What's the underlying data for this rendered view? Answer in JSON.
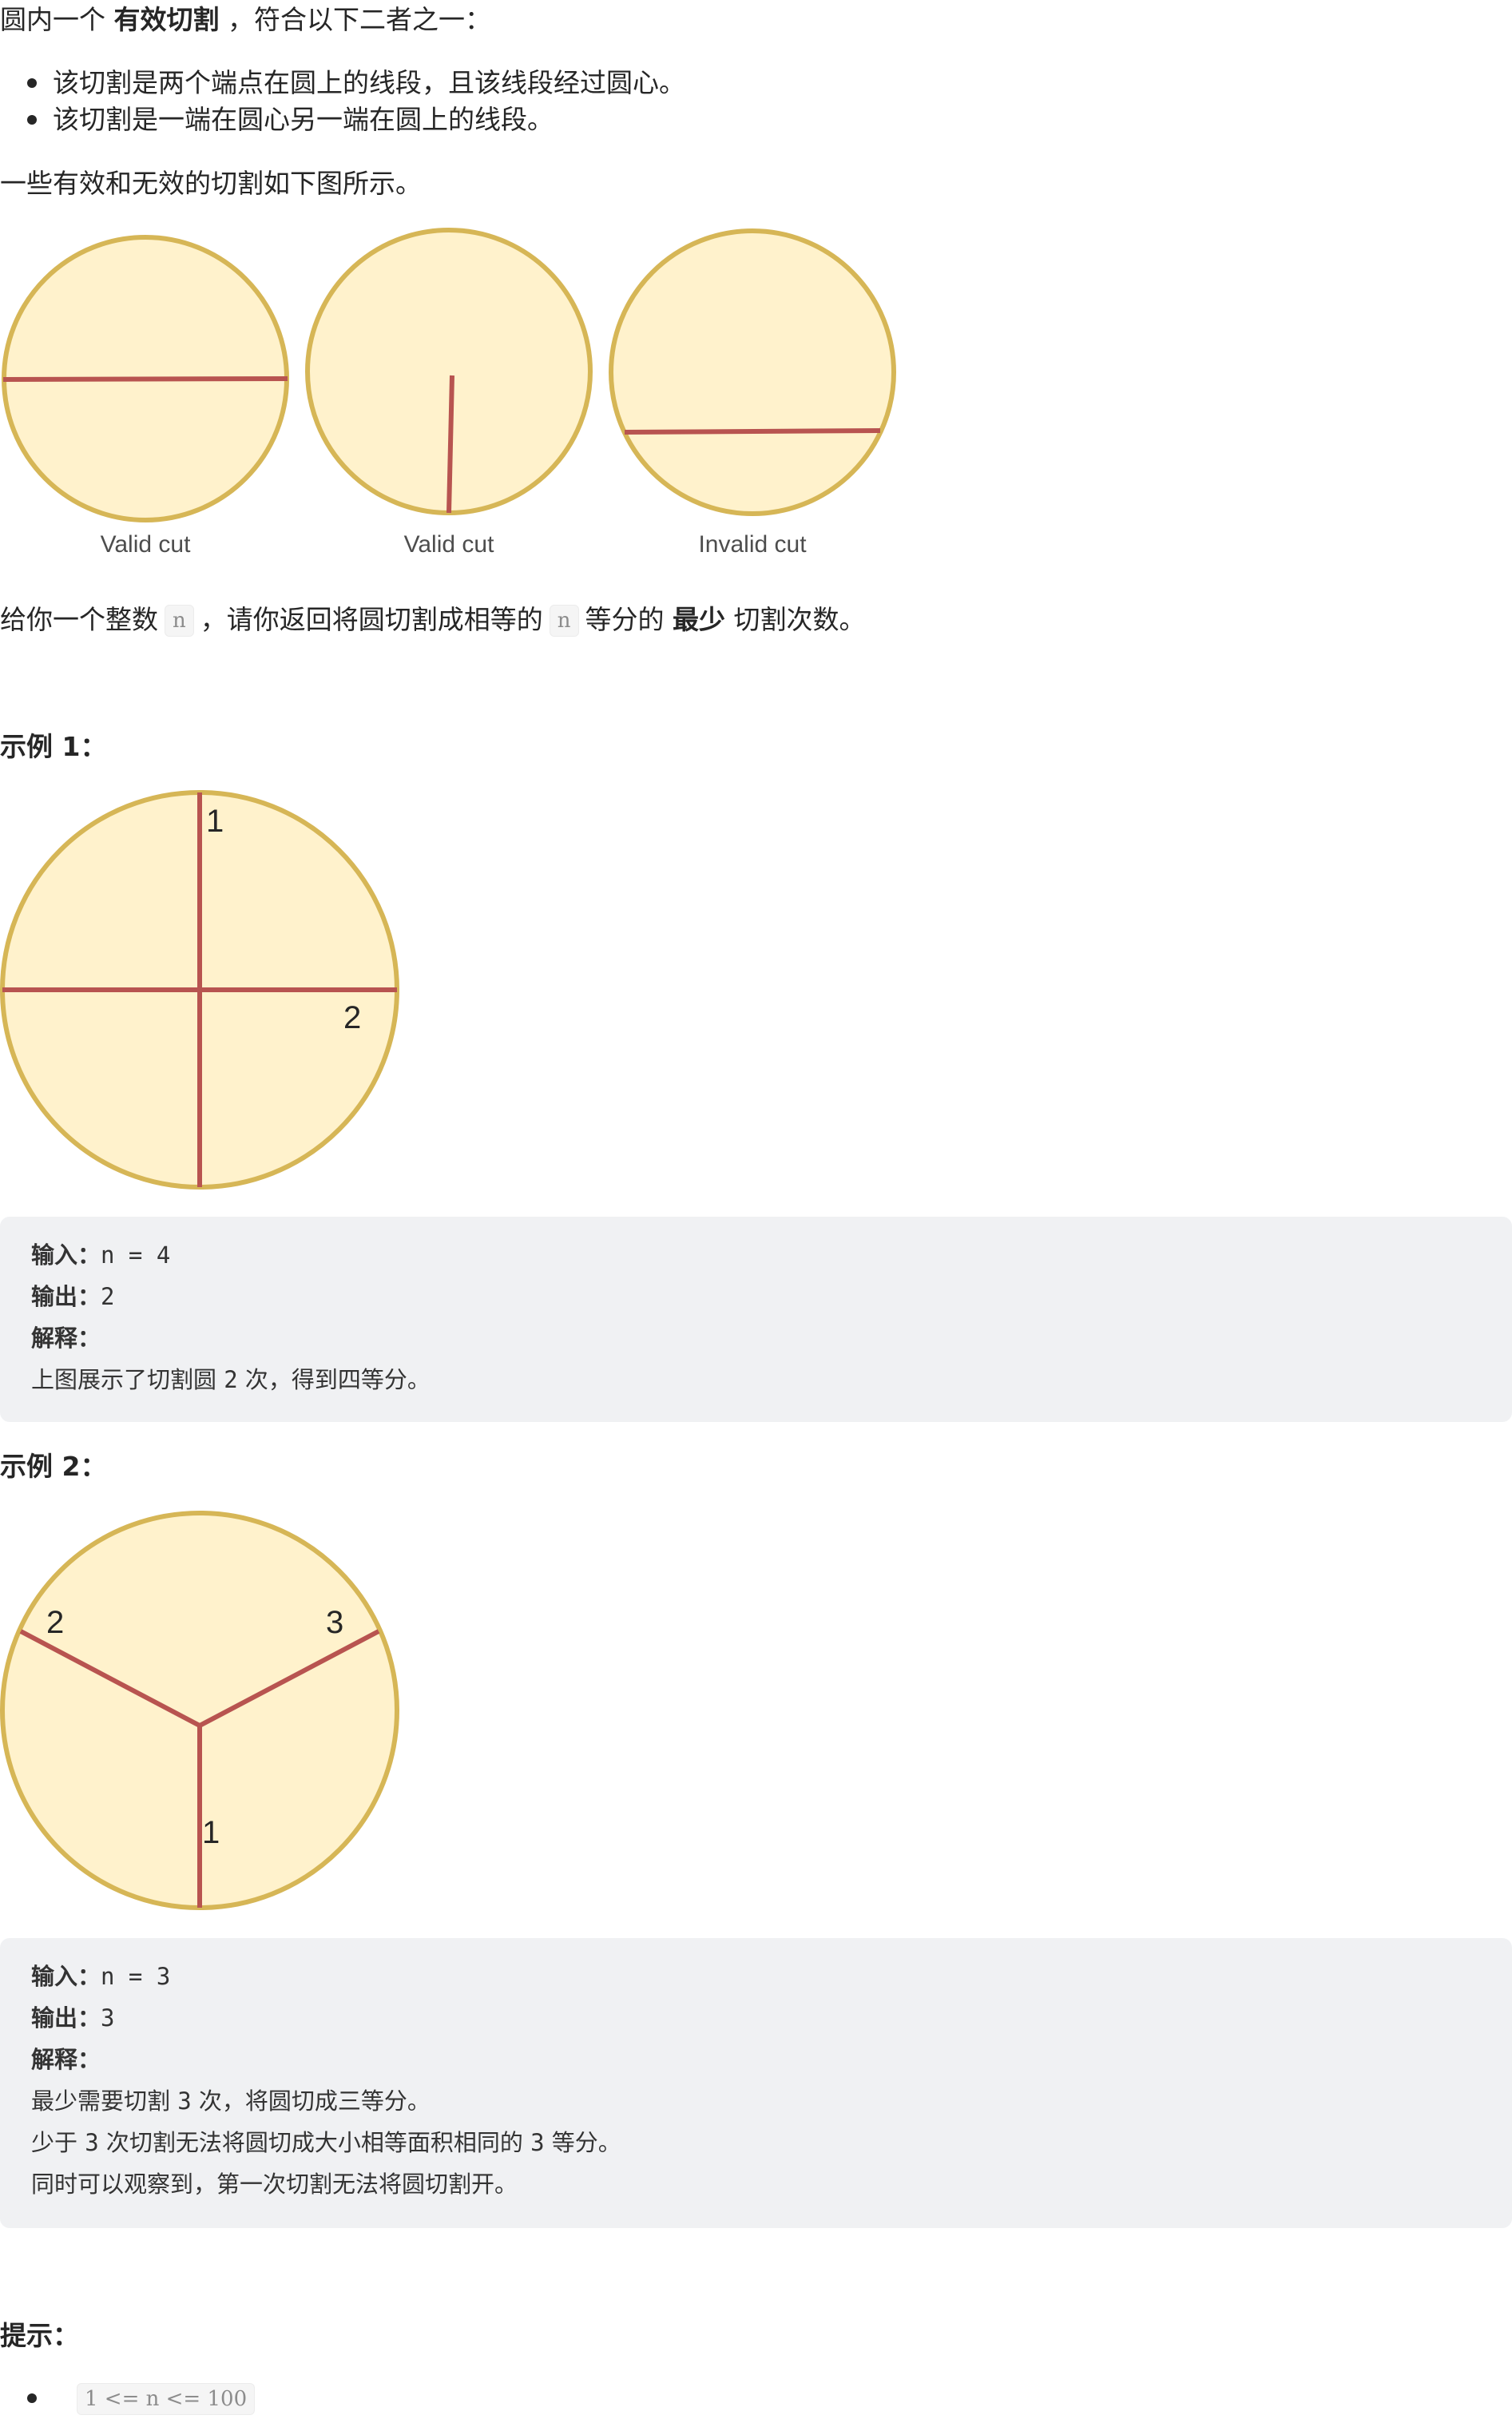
{
  "intro": {
    "prefix": "圆内一个 ",
    "emphasis": "有效切割",
    "suffix": " ，符合以下二者之一："
  },
  "rules": [
    "该切割是两个端点在圆上的线段，且该线段经过圆心。",
    "该切割是一端在圆心另一端在圆上的线段。"
  ],
  "figure_caption_intro": "一些有效和无效的切割如下图所示。",
  "figure_labels": [
    "Valid cut",
    "Valid cut",
    "Invalid cut"
  ],
  "task": {
    "prefix": "给你一个整数",
    "var": "n",
    "middle": "，请你返回将圆切割成相等的",
    "var2": "n",
    "middle2": "等分的 ",
    "emphasis": "最少",
    "suffix": " 切割次数。"
  },
  "examples": [
    {
      "title": "示例 1：",
      "cut_labels": [
        "1",
        "2"
      ],
      "input_label": "输入：",
      "input_value": "n = 4",
      "output_label": "输出：",
      "output_value": "2",
      "explain_label": "解释：",
      "explain_lines": [
        [
          "上图展示了切割圆 ",
          "2",
          " 次，得到四等分。"
        ]
      ]
    },
    {
      "title": "示例 2：",
      "cut_labels": [
        "2",
        "3",
        "1"
      ],
      "input_label": "输入：",
      "input_value": "n = 3",
      "output_label": "输出：",
      "output_value": "3",
      "explain_label": "解释：",
      "explain_lines": [
        [
          "最少需要切割 ",
          "3",
          " 次，将圆切成三等分。"
        ],
        [
          "少于 ",
          "3",
          " 次切割无法将圆切成大小相等面积相同的 ",
          "3",
          " 等分。"
        ],
        [
          "同时可以观察到，第一次切割无法将圆切割开。"
        ]
      ]
    }
  ],
  "hints": {
    "title": "提示：",
    "items": [
      "1 <= n <= 100"
    ]
  },
  "colors": {
    "circle_fill": "#fff2cc",
    "circle_stroke": "#d6b656",
    "cut_line": "#b85450",
    "code_bg": "#f0f1f3"
  }
}
